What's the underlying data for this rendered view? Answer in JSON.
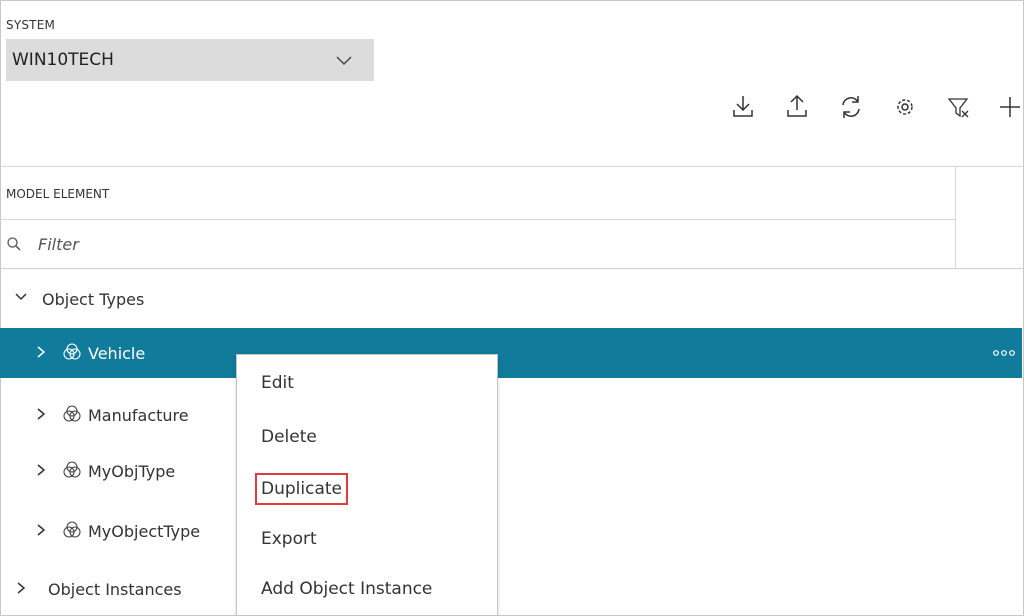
{
  "system": {
    "label": "SYSTEM",
    "value": "WIN10TECH"
  },
  "toolbar": {
    "icons": [
      "download-icon",
      "upload-icon",
      "refresh-icon",
      "settings-icon",
      "clear-filter-icon",
      "add-icon"
    ]
  },
  "grid": {
    "column_header": "MODEL ELEMENT",
    "filter_placeholder": "Filter"
  },
  "tree": {
    "object_types": "Object Types",
    "items": [
      {
        "label": "Vehicle",
        "selected": true
      },
      {
        "label": "Manufacture"
      },
      {
        "label": "MyObjType"
      },
      {
        "label": "MyObjectType"
      }
    ],
    "object_instances": "Object Instances"
  },
  "context_menu": {
    "items": [
      "Edit",
      "Delete",
      "Duplicate",
      "Export",
      "Add Object Instance"
    ],
    "highlighted": "Duplicate"
  },
  "colors": {
    "selected_row": "#107b9a",
    "highlight_box": "#e03c3c",
    "select_bg": "#dcdcdc"
  }
}
